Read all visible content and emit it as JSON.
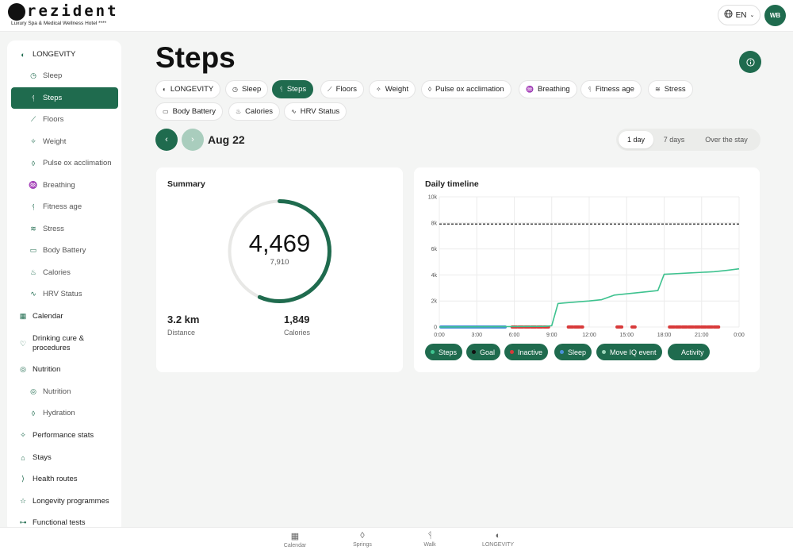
{
  "header": {
    "brand": "rezident",
    "brand_sub": "Luxury Spa & Medical Wellness Hotel ****",
    "lang": "EN",
    "avatar_initials": "WB"
  },
  "sidebar": {
    "items": [
      {
        "label": "LONGEVITY",
        "icon": "longevity-icon",
        "level": "top"
      },
      {
        "label": "Sleep",
        "icon": "clock-icon",
        "level": "sub"
      },
      {
        "label": "Steps",
        "icon": "walk-icon",
        "level": "sub",
        "active": true
      },
      {
        "label": "Floors",
        "icon": "stairs-icon",
        "level": "sub"
      },
      {
        "label": "Weight",
        "icon": "sparkle-icon",
        "level": "sub"
      },
      {
        "label": "Pulse ox acclimation",
        "icon": "drop-icon",
        "level": "sub"
      },
      {
        "label": "Breathing",
        "icon": "lungs-icon",
        "level": "sub"
      },
      {
        "label": "Fitness age",
        "icon": "run-icon",
        "level": "sub"
      },
      {
        "label": "Stress",
        "icon": "stress-icon",
        "level": "sub"
      },
      {
        "label": "Body Battery",
        "icon": "battery-icon",
        "level": "sub"
      },
      {
        "label": "Calories",
        "icon": "flame-icon",
        "level": "sub"
      },
      {
        "label": "HRV Status",
        "icon": "pulse-icon",
        "level": "sub"
      },
      {
        "label": "Calendar",
        "icon": "calendar-icon",
        "level": "top"
      },
      {
        "label": "Drinking cure & procedures",
        "icon": "heart-icon",
        "level": "top"
      },
      {
        "label": "Nutrition",
        "icon": "target-icon",
        "level": "top"
      },
      {
        "label": "Nutrition",
        "icon": "target-icon",
        "level": "sub"
      },
      {
        "label": "Hydration",
        "icon": "drop-icon",
        "level": "sub"
      },
      {
        "label": "Performance stats",
        "icon": "sparkle-icon",
        "level": "top"
      },
      {
        "label": "Stays",
        "icon": "building-icon",
        "level": "top"
      },
      {
        "label": "Health routes",
        "icon": "route-icon",
        "level": "top"
      },
      {
        "label": "Longevity programmes",
        "icon": "star-icon",
        "level": "top"
      },
      {
        "label": "Functional tests",
        "icon": "dumbbell-icon",
        "level": "top"
      }
    ]
  },
  "main": {
    "title": "Steps",
    "chips": [
      {
        "label": "LONGEVITY"
      },
      {
        "label": "Sleep"
      },
      {
        "label": "Steps",
        "active": true
      },
      {
        "label": "Floors"
      },
      {
        "label": "Weight"
      },
      {
        "label": "Pulse ox acclimation"
      },
      {
        "label": "Breathing"
      },
      {
        "label": "Fitness age"
      },
      {
        "label": "Stress"
      },
      {
        "label": "Body Battery"
      },
      {
        "label": "Calories"
      },
      {
        "label": "HRV Status"
      }
    ],
    "date": "Aug 22",
    "ranges": [
      {
        "label": "1 day",
        "active": true
      },
      {
        "label": "7 days"
      },
      {
        "label": "Over the stay"
      }
    ]
  },
  "summary": {
    "title": "Summary",
    "steps": "4,469",
    "goal": "7,910",
    "progress": 0.565,
    "distance_value": "3.2 km",
    "distance_label": "Distance",
    "calories_value": "1,849",
    "calories_label": "Calories"
  },
  "timeline": {
    "title": "Daily timeline",
    "legend": [
      {
        "label": "Steps",
        "color": "#3ec28f"
      },
      {
        "label": "Goal",
        "color": "#111111"
      },
      {
        "label": "Inactive",
        "color": "#d83a3a"
      },
      {
        "label": "Sleep",
        "color": "#4b90d9"
      },
      {
        "label": "Move IQ event",
        "color": "#9bd3b8"
      },
      {
        "label": "Activity",
        "color": "#1f6b4e"
      }
    ]
  },
  "chart_data": {
    "type": "line",
    "title": "Daily timeline",
    "xlabel": "",
    "ylabel": "",
    "x_ticks": [
      "0:00",
      "3:00",
      "6:00",
      "9:00",
      "12:00",
      "15:00",
      "18:00",
      "21:00",
      "0:00"
    ],
    "y_ticks": [
      "0",
      "2k",
      "4k",
      "6k",
      "8k",
      "10k"
    ],
    "ylim": [
      0,
      10000
    ],
    "xlim_hours": [
      0,
      24
    ],
    "goal": 7910,
    "series": [
      {
        "name": "Steps",
        "x": [
          0,
          8.5,
          9,
          9.5,
          10,
          12,
          13,
          14,
          15,
          16,
          17,
          17.5,
          18,
          19,
          20,
          21,
          22,
          23,
          24
        ],
        "y": [
          0,
          50,
          100,
          1800,
          1850,
          2000,
          2100,
          2450,
          2550,
          2650,
          2750,
          2800,
          4050,
          4100,
          4150,
          4200,
          4250,
          4350,
          4469
        ]
      }
    ],
    "bars": {
      "sleep": [
        [
          0,
          5.4
        ]
      ],
      "inactive": [
        [
          5.7,
          9
        ],
        [
          10.2,
          11.6
        ],
        [
          14.1,
          14.8
        ],
        [
          15.3,
          15.8
        ],
        [
          18.3,
          22.5
        ]
      ]
    }
  },
  "bottom_nav": {
    "items": [
      {
        "label": "Calendar",
        "icon": "calendar-icon"
      },
      {
        "label": "Springs",
        "icon": "drop-icon"
      },
      {
        "label": "Walk",
        "icon": "walk-icon"
      },
      {
        "label": "LONGEVITY",
        "icon": "longevity-icon"
      }
    ]
  }
}
